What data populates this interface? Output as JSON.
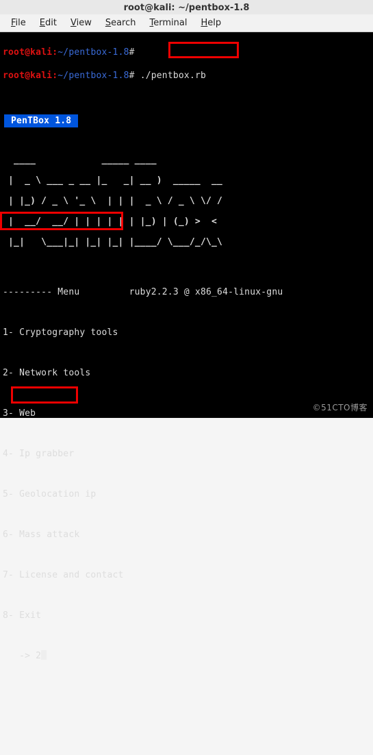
{
  "titlebar": {
    "text": "root@kali: ~/pentbox-1.8"
  },
  "menubar": {
    "file": "File",
    "edit": "Edit",
    "view": "View",
    "search": "Search",
    "terminal": "Terminal",
    "help": "Help"
  },
  "prompt1": {
    "user": "root",
    "at": "@",
    "host": "kali",
    "colon": ":",
    "path": "~/pentbox-1.8",
    "hash": "#"
  },
  "prompt2": {
    "user": "root",
    "at": "@",
    "host": "kali",
    "colon": ":",
    "path": "~/pentbox-1.8",
    "hash": "#"
  },
  "command": "./pentbox.rb",
  "banner": " PenTBox 1.8 ",
  "ascii": [
    "  ____            _____ ____",
    " |  _ \\ ___ _ __ |_   _| __ )  _____  __",
    " | |_) / _ \\ '_ \\  | | |  _ \\ / _ \\ \\/ /",
    " |  __/  __/ | | | | | | |_) | (_) >  <",
    " |_|   \\___|_| |_| |_| |____/ \\___/_/\\_\\"
  ],
  "menu_header": {
    "dashes": "--------- Menu",
    "ruby": "ruby2.2.3 @ x86_64-linux-gnu"
  },
  "options": {
    "o1": "1- Cryptography tools",
    "o2": "2- Network tools",
    "o3": "3- Web",
    "o4": "4- Ip grabber",
    "o5": "5- Geolocation ip",
    "o6": "6- Mass attack",
    "o7": "7- License and contact",
    "o8": "8- Exit"
  },
  "input": {
    "prompt": "   -> ",
    "value": "2"
  },
  "watermark": "©51CTO博客"
}
